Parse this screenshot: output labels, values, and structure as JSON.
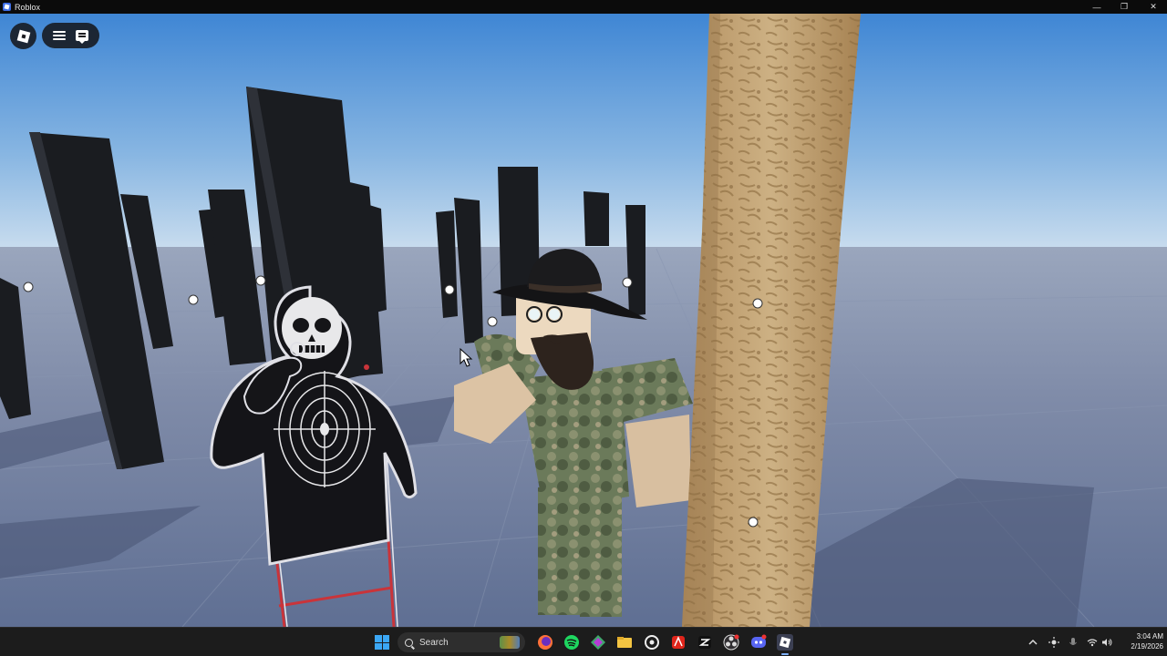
{
  "window": {
    "title": "Roblox",
    "minimize_glyph": "—",
    "restore_glyph": "❐",
    "close_glyph": "✕"
  },
  "game_ui": {
    "roblox_menu_icon": "roblox-logo-icon",
    "hamburger_icon": "menu-icon",
    "chat_icon": "chat-icon"
  },
  "taskbar": {
    "search_label": "Search",
    "pinned_apps": [
      "start-icon",
      "firefox-icon",
      "spotify-icon",
      "vs-code-icon",
      "file-explorer-icon",
      "steam-icon",
      "acrobat-icon",
      "capcut-icon",
      "obs-icon",
      "discord-icon",
      "roblox-icon"
    ],
    "tray_icons": [
      "chevron-up-icon",
      "brightness-icon",
      "mic-icon",
      "wifi-icon",
      "volume-icon"
    ],
    "time": "3:04 AM",
    "date": "2/19/2026"
  },
  "colors": {
    "sky_top": "#3f86d4",
    "sky_horizon": "#b9d3ea",
    "ground": "#6a7a9a",
    "pillar": "#1a1c20",
    "tree_trunk": "#c2a47a",
    "taskbar": "#1c1c1c",
    "accent": "#3ba7f5"
  }
}
